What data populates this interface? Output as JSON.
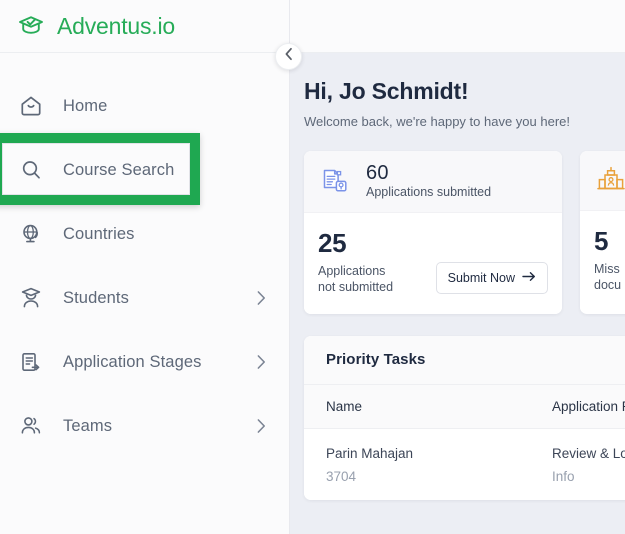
{
  "brand": {
    "name": "Adventus.io",
    "logo_icon": "graduation-cap-check-icon",
    "accent_color": "#27ac58"
  },
  "sidebar": {
    "collapse_icon": "chevron-left-icon",
    "highlight_color": "#1fa851",
    "items": [
      {
        "label": "Home",
        "icon": "home-icon",
        "has_chevron": false,
        "highlighted": false
      },
      {
        "label": "Course Search",
        "icon": "search-icon",
        "has_chevron": false,
        "highlighted": true
      },
      {
        "label": "Countries",
        "icon": "globe-icon",
        "has_chevron": false,
        "highlighted": false
      },
      {
        "label": "Students",
        "icon": "student-graduate-icon",
        "has_chevron": true,
        "highlighted": false
      },
      {
        "label": "Application Stages",
        "icon": "document-arrow-icon",
        "has_chevron": true,
        "highlighted": false
      },
      {
        "label": "Teams",
        "icon": "people-icon",
        "has_chevron": true,
        "highlighted": false
      }
    ],
    "chevron_icon": "chevron-right-icon"
  },
  "main": {
    "greeting": {
      "title": "Hi, Jo Schmidt!",
      "subtitle": "Welcome back, we're happy to have you here!"
    },
    "stat_cards": [
      {
        "top": {
          "icon": "documents-submitted-icon",
          "icon_color": "#7b93e8",
          "number": "60",
          "label": "Applications submitted"
        },
        "bottom": {
          "number": "25",
          "label": "Applications\nnot submitted",
          "label_line1": "Applications",
          "label_line2": "not submitted",
          "button_label": "Submit Now",
          "button_icon": "arrow-right-icon"
        }
      },
      {
        "top": {
          "icon": "university-building-icon",
          "icon_color": "#e9a13b",
          "number": "",
          "label": ""
        },
        "bottom": {
          "number": "5",
          "label_line1": "Miss",
          "label_line2": "docu"
        }
      }
    ],
    "tasks": {
      "title": "Priority Tasks",
      "columns": [
        "Name",
        "Application P"
      ],
      "rows": [
        {
          "name_primary": "Parin Mahajan",
          "name_secondary": "3704",
          "app_primary": "Review & Loc",
          "app_secondary": "Info"
        }
      ]
    }
  }
}
